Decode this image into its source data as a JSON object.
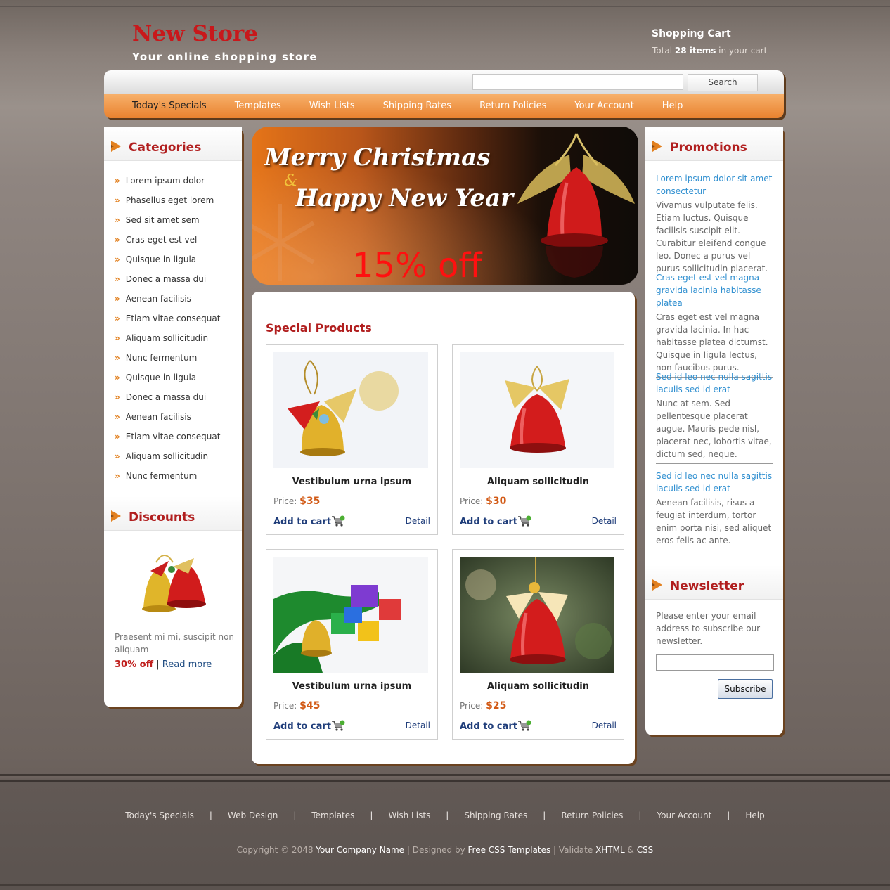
{
  "header": {
    "site_title": "New Store",
    "slogan": "Your online shopping store",
    "cart_title": "Shopping Cart",
    "cart_prefix": "Total ",
    "cart_count": "28 items",
    "cart_suffix": " in your cart"
  },
  "search": {
    "placeholder": "",
    "button": "Search"
  },
  "menu": [
    "Today's Specials",
    "Templates",
    "Wish Lists",
    "Shipping Rates",
    "Return Policies",
    "Your Account",
    "Help"
  ],
  "categories": {
    "title": "Categories",
    "bullet": "»",
    "items": [
      "Lorem ipsum dolor",
      "Phasellus eget lorem",
      "Sed sit amet sem",
      "Cras eget est vel",
      "Quisque in ligula",
      "Donec a massa dui",
      "Aenean facilisis",
      "Etiam vitae consequat",
      "Aliquam sollicitudin",
      "Nunc fermentum",
      "Quisque in ligula",
      "Donec a massa dui",
      "Aenean facilisis",
      "Etiam vitae consequat",
      "Aliquam sollicitudin",
      "Nunc fermentum"
    ]
  },
  "discounts": {
    "title": "Discounts",
    "text": "Praesent mi mi, suscipit non aliquam",
    "percent": "30% off",
    "separator": "|",
    "read_more": "Read more"
  },
  "banner": {
    "line1": "Merry Christmas",
    "amp": "&",
    "line2": "Happy New Year",
    "offer": "15% off"
  },
  "special": {
    "title": "Special Products",
    "price_label": "Price:",
    "add_label": "Add to cart",
    "detail_label": "Detail",
    "products": [
      {
        "name": "Vestibulum urna ipsum",
        "price": "$35"
      },
      {
        "name": "Aliquam sollicitudin",
        "price": "$30"
      },
      {
        "name": "Vestibulum urna ipsum",
        "price": "$45"
      },
      {
        "name": "Aliquam sollicitudin",
        "price": "$25"
      }
    ]
  },
  "promotions": {
    "title": "Promotions",
    "items": [
      {
        "head": "Lorem ipsum dolor sit amet consectetur",
        "text": "Vivamus vulputate felis. Etiam luctus. Quisque facilisis suscipit elit. Curabitur eleifend congue leo. Donec a purus vel purus sollicitudin placerat."
      },
      {
        "head": "Cras eget est vel magna gravida lacinia habitasse platea",
        "text": "Cras eget est vel magna gravida lacinia. In hac habitasse platea dictumst. Quisque in ligula lectus, non faucibus purus."
      },
      {
        "head": "Sed id leo nec nulla sagittis iaculis sed id erat",
        "text": "Nunc at sem. Sed pellentesque placerat augue. Mauris pede nisl, placerat nec, lobortis vitae, dictum sed, neque."
      },
      {
        "head": "Sed id leo nec nulla sagittis iaculis sed id erat",
        "text": "Aenean facilisis, risus a feugiat interdum, tortor enim porta nisi, sed aliquet eros felis ac ante."
      }
    ]
  },
  "newsletter": {
    "title": "Newsletter",
    "text": "Please enter your email address to subscribe our newsletter.",
    "input_value": "",
    "button": "Subscribe"
  },
  "footer": {
    "menu": [
      "Today's Specials",
      "Web Design",
      "Templates",
      "Wish Lists",
      "Shipping Rates",
      "Return Policies",
      "Your Account",
      "Help"
    ],
    "separator": "|",
    "copyright_prefix": "Copyright © 2048 ",
    "company": "Your Company Name",
    "designed_by": " | Designed by ",
    "designer": "Free CSS Templates",
    "validate": " | Validate ",
    "xhtml": "XHTML",
    "amp": " & ",
    "css": "CSS"
  },
  "colors": {
    "accent": "#e9822f",
    "title_red": "#b11f1f",
    "link_blue": "#1f3d7a",
    "promo_blue": "#2f8fd0",
    "price_orange": "#d25a16"
  }
}
